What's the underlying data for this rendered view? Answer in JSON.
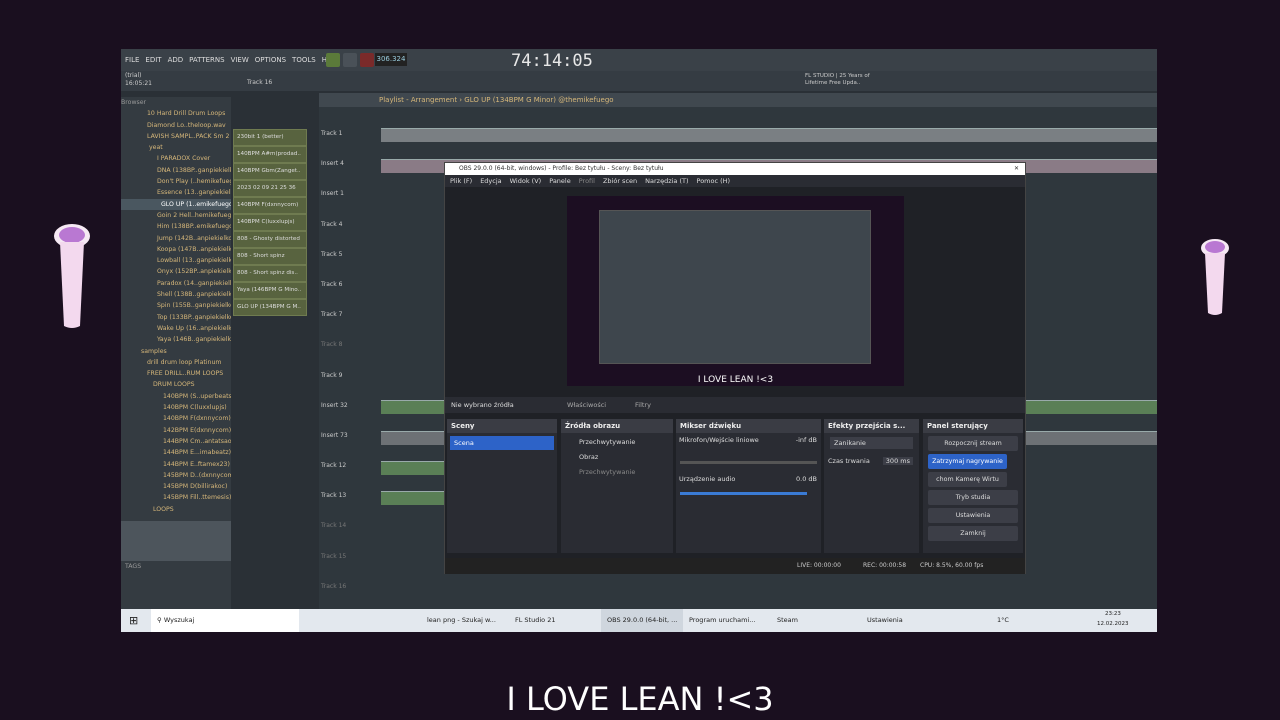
{
  "fl": {
    "menu": [
      "FILE",
      "EDIT",
      "ADD",
      "PATTERNS",
      "VIEW",
      "OPTIONS",
      "TOOLS",
      "HELP"
    ],
    "tempo": "306.324",
    "time": "74:14:05",
    "trial": "(trial)",
    "clock": "16:05:21",
    "track_label": "Track 16",
    "news": "FL STUDIO | 25 Years of Lifetime Free Upda..",
    "playlist_title": "Playlist - Arrangement › GLO UP (134BPM G Minor) @themikefuego",
    "browser_label": "Browser",
    "browser_items": [
      "10 Hard Drill Drum Loops",
      "Diamond Lo..theloop.wav",
      "LAVISH SAMPL..PACK Sm 2",
      "yeat",
      "I PARADOX Cover",
      "DNA (138BP..ganpiekielko",
      "Don't Play (..hemikefuego",
      "Essence (13..ganpiekielko",
      "GLO UP (1..emikefuego",
      "Goin 2 Hell..hemikefuego",
      "Him (138BP..emikefuego",
      "Jump (142B..anpiekielko",
      "Koopa (147B..anpiekielko",
      "Lowball (13..ganpiekielko",
      "Onyx (152BP..anpiekielko",
      "Paradox (14..ganpiekielko",
      "Shell (138B..ganpiekielko",
      "Spin (155B..ganpiekielko",
      "Top (133BP..ganpiekielko",
      "Wake Up (16..anpiekielko",
      "Yaya (146B..ganpiekielko",
      "samples",
      "drill drum loop Platinum",
      "FREE DRILL..RUM LOOPS",
      "DRUM LOOPS",
      "140BPM (S..uperbeats)",
      "140BPM C(luxxlupjs)",
      "140BPM F(dxnnycom)",
      "142BPM E(dxnnycom)",
      "144BPM Cm..antatsao)",
      "144BPM E...imabeatz)",
      "144BPM E..ftamex23)",
      "145BPM D..(dxnnycom)",
      "145BPM D(billirakoc)",
      "145BPM Fill..ttemesis)",
      "LOOPS"
    ],
    "browser_tags": "TAGS",
    "channels": [
      "230bit 1 (better)",
      "140BPM A#m(prodad..",
      "140BPM Gbm(Zanget..",
      "2023 02 09 21 25 36",
      "140BPM F(dxnnycom)",
      "140BPM C(luxxlupjs)",
      "808 - Ghosty distorted",
      "808 - Short spinz",
      "808 - Short spinz dis..",
      "Yaya (146BPM G Mino..",
      "GLO UP (134BPM G M.."
    ],
    "tracks": [
      "Track 1",
      "Insert 4",
      "Insert 1",
      "Track 4",
      "Track 5",
      "Track 6",
      "Track 7",
      "Track 8",
      "Track 9",
      "Insert 32",
      "Insert 73",
      "Track 12",
      "Track 13",
      "Track 14",
      "Track 15",
      "Track 16"
    ]
  },
  "obs": {
    "title": "OBS 29.0.0 (64-bit, windows) - Profile: Bez tytułu - Sceny: Bez tytułu",
    "menu": [
      "Plik (F)",
      "Edycja",
      "Widok (V)",
      "Panele",
      "Profil",
      "Zbiór scen",
      "Narzędzia (T)",
      "Pomoc (H)"
    ],
    "preview_caption": "I LOVE LEAN !<3",
    "no_source": "Nie wybrano źródła",
    "properties": "Właściwości",
    "filters": "Filtry",
    "scenes_title": "Sceny",
    "scene_item": "Scena",
    "sources_title": "Źródła obrazu",
    "sources": [
      "Przechwytywanie",
      "Obraz",
      "Przechwytywanie"
    ],
    "mixer_title": "Mikser dźwięku",
    "mic_label": "Mikrofon/Wejście liniowe",
    "mic_level": "-inf dB",
    "desktop_label": "Urządzenie audio",
    "desktop_level": "0.0 dB",
    "trans_title": "Efekty przejścia s...",
    "trans_select": "Zanikanie",
    "trans_dur_label": "Czas trwania",
    "trans_dur": "300 ms",
    "controls_title": "Panel sterujący",
    "controls": [
      "Rozpocznij stream",
      "Zatrzymaj nagrywanie",
      "chom Kamerę Wirtu",
      "Tryb studia",
      "Ustawienia",
      "Zamknij"
    ],
    "status_live": "LIVE: 00:00:00",
    "status_rec": "REC: 00:00:58",
    "status_cpu": "CPU: 8.5%, 60.00 fps"
  },
  "taskbar": {
    "search": "Wyszukaj",
    "apps": [
      "lean png - Szukaj w...",
      "FL Studio 21",
      "OBS 29.0.0 (64-bit, ...",
      "Program uruchami...",
      "Steam",
      "Ustawienia"
    ],
    "weather": "1°C",
    "time": "23:23",
    "date": "12.02.2023"
  },
  "caption": "I LOVE LEAN !<3"
}
